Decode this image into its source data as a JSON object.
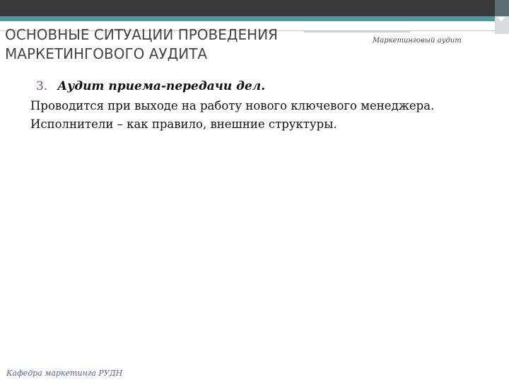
{
  "slide": {
    "title": "ОСНОВНЫЕ СИТУАЦИИ ПРОВЕДЕНИЯ\nМАРКЕТИНГОВОГО АУДИТА",
    "header_note": "Маркетинговый аудит",
    "point_number": "3.",
    "point_title": "Аудит приема-передачи дел.",
    "body_lines": [
      "Проводится при выходе на работу нового ключевого менеджера.",
      "Исполнители – как правило, внешние структуры."
    ],
    "footer": "Кафедра маркетинга РУДН"
  },
  "colors": {
    "top_bar": "#3a3a3a",
    "accent_teal": "#4e9a9c",
    "number_accent": "#7a4a86",
    "footer_text": "#5a5aa8"
  }
}
